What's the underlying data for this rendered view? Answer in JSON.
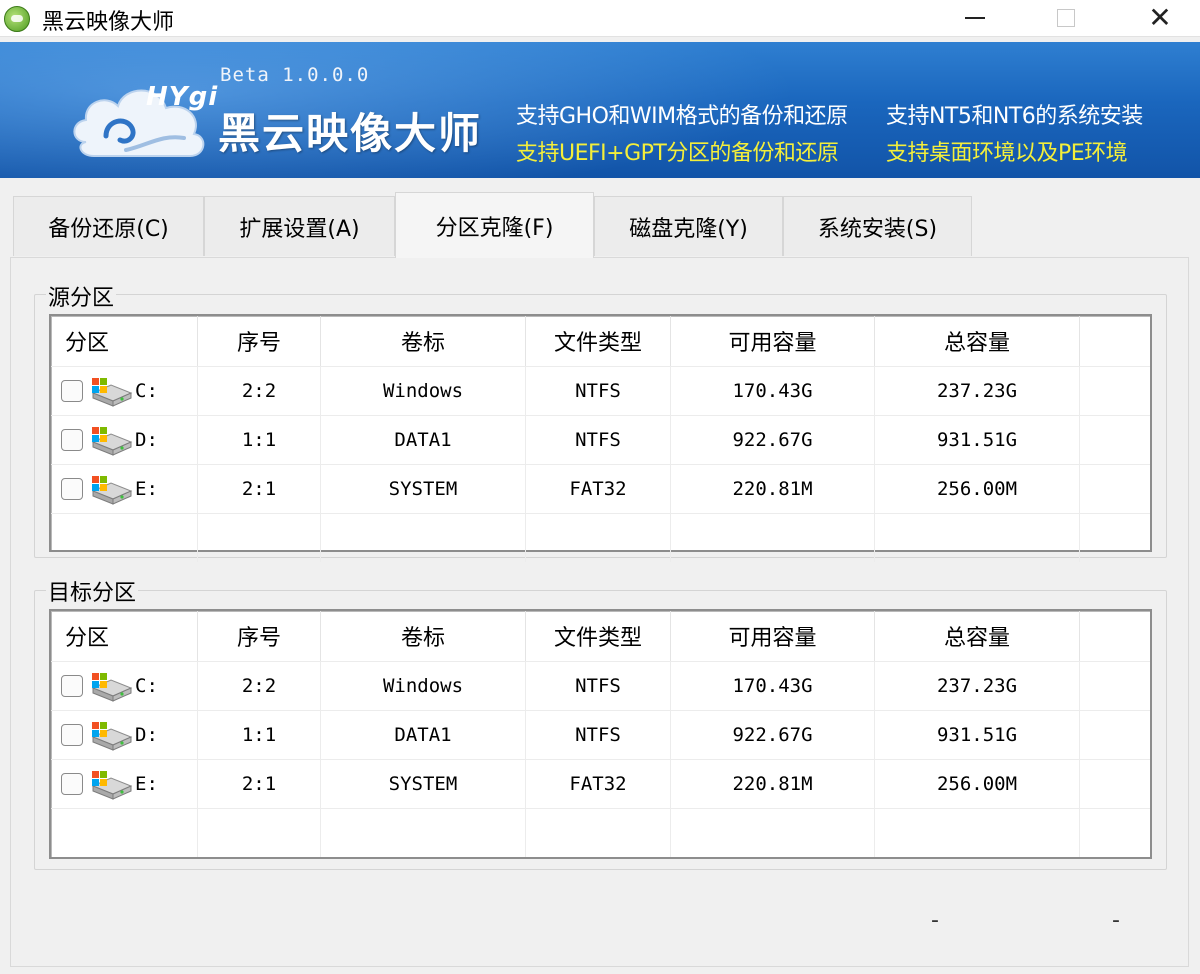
{
  "window": {
    "title": "黑云映像大师",
    "icon": "cloud-app-icon"
  },
  "banner": {
    "logo_text": "HYgi",
    "version": "Beta 1.0.0.0",
    "product_name": "黑云映像大师",
    "features": [
      {
        "text": "支持GHO和WIM格式的备份和还原",
        "color": "#ffffff"
      },
      {
        "text": "支持NT5和NT6的系统安装",
        "color": "#ffffff"
      },
      {
        "text": "支持UEFI+GPT分区的备份和还原",
        "color": "#f4ef3a"
      },
      {
        "text": "支持桌面环境以及PE环境",
        "color": "#f4ef3a"
      }
    ]
  },
  "tabs": [
    {
      "label": "备份还原(C)",
      "active": false
    },
    {
      "label": "扩展设置(A)",
      "active": false
    },
    {
      "label": "分区克隆(F)",
      "active": true
    },
    {
      "label": "磁盘克隆(Y)",
      "active": false
    },
    {
      "label": "系统安装(S)",
      "active": false
    }
  ],
  "columns": [
    "分区",
    "序号",
    "卷标",
    "文件类型",
    "可用容量",
    "总容量"
  ],
  "source": {
    "label": "源分区",
    "rows": [
      {
        "drive": "C:",
        "index": "2:2",
        "volume": "Windows",
        "fs": "NTFS",
        "free": "170.43G",
        "total": "237.23G",
        "checked": false
      },
      {
        "drive": "D:",
        "index": "1:1",
        "volume": "DATA1",
        "fs": "NTFS",
        "free": "922.67G",
        "total": "931.51G",
        "checked": false
      },
      {
        "drive": "E:",
        "index": "2:1",
        "volume": "SYSTEM",
        "fs": "FAT32",
        "free": "220.81M",
        "total": "256.00M",
        "checked": false
      }
    ]
  },
  "target": {
    "label": "目标分区",
    "rows": [
      {
        "drive": "C:",
        "index": "2:2",
        "volume": "Windows",
        "fs": "NTFS",
        "free": "170.43G",
        "total": "237.23G",
        "checked": false
      },
      {
        "drive": "D:",
        "index": "1:1",
        "volume": "DATA1",
        "fs": "NTFS",
        "free": "922.67G",
        "total": "931.51G",
        "checked": false
      },
      {
        "drive": "E:",
        "index": "2:1",
        "volume": "SYSTEM",
        "fs": "FAT32",
        "free": "220.81M",
        "total": "256.00M",
        "checked": false
      }
    ]
  },
  "status": {
    "left": "-",
    "right": "-"
  },
  "colors": {
    "banner": "#1a66bd",
    "highlight_text": "#f4ef3a"
  }
}
